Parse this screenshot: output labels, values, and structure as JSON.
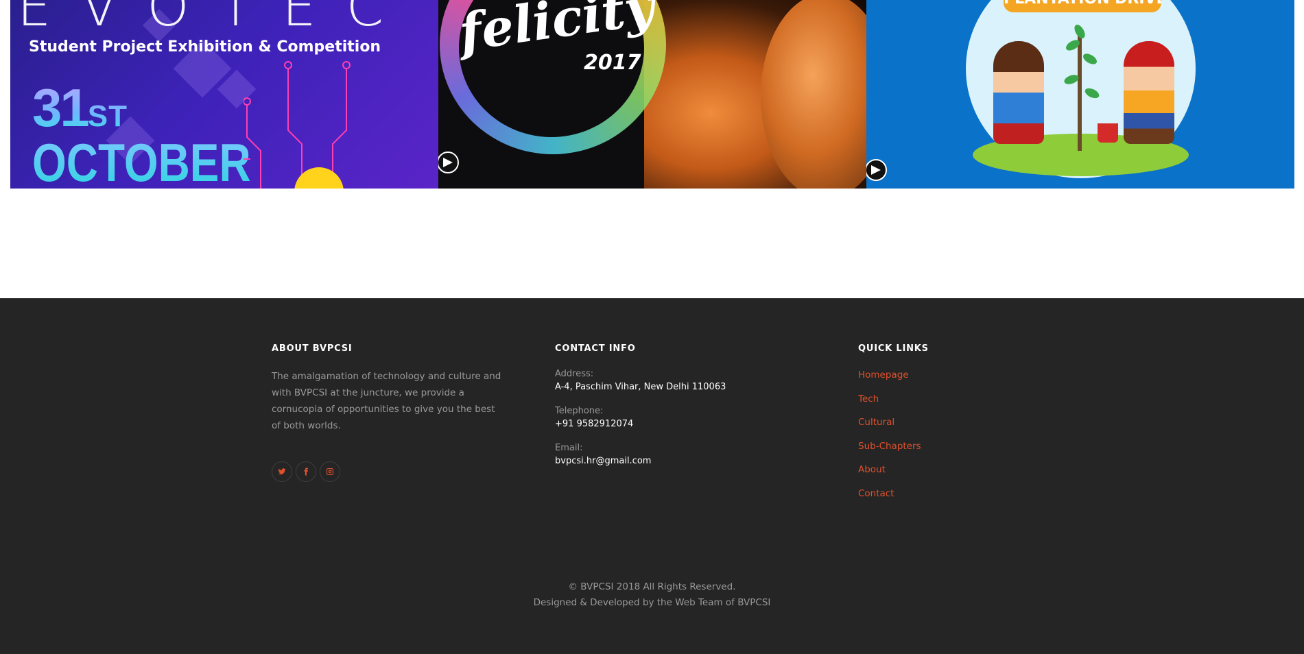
{
  "gallery": {
    "evotec": {
      "word": "EVOTEC",
      "subtitle": "Student Project Exhibition & Competition",
      "date_number": "31",
      "date_suffix": "ST",
      "date_month": "OCTOBER"
    },
    "felicity": {
      "word": "felicity",
      "year": "2017"
    },
    "plantation": {
      "ribbon": "PLANTATION DRIVE"
    }
  },
  "footer": {
    "about": {
      "title": "ABOUT BVPCSI",
      "text": "The amalgamation of technology and culture and with BVPCSI at the juncture, we provide a cornucopia of opportunities to give you the best of both worlds.",
      "socials": [
        {
          "icon": "twitter-icon"
        },
        {
          "icon": "facebook-icon"
        },
        {
          "icon": "instagram-icon"
        }
      ]
    },
    "contact": {
      "title": "CONTACT INFO",
      "address_label": "Address:",
      "address_value": "A-4, Paschim Vihar, New Delhi 110063",
      "telephone_label": "Telephone:",
      "telephone_value": "+91 9582912074",
      "email_label": "Email:",
      "email_value": "bvpcsi.hr@gmail.com"
    },
    "links": {
      "title": "QUICK LINKS",
      "items": [
        "Homepage",
        "Tech",
        "Cultural",
        "Sub-Chapters",
        "About",
        "Contact"
      ]
    },
    "copyright": "© BVPCSI 2018 All Rights Reserved.",
    "credits": "Designed & Developed by the Web Team of BVPCSI"
  },
  "colors": {
    "footer_bg": "#252525",
    "accent": "#e0512c",
    "muted_text": "#9a9a9a"
  }
}
